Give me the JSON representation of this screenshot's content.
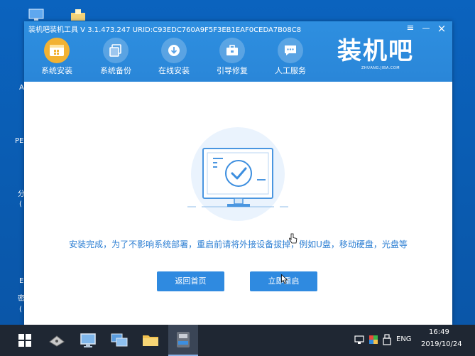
{
  "window": {
    "title": "装机吧装机工具 V 3.1.473.247 URID:C93EDC760A9F5F3EB1EAF0CEDA7B08C8",
    "controls": {
      "menu": "≡",
      "minimize": "—",
      "close": "×"
    }
  },
  "nav": {
    "items": [
      {
        "label": "系统安装",
        "icon": "windows-install-icon",
        "active": true
      },
      {
        "label": "系统备份",
        "icon": "backup-icon",
        "active": false
      },
      {
        "label": "在线安装",
        "icon": "download-icon",
        "active": false
      },
      {
        "label": "引导修复",
        "icon": "toolbox-icon",
        "active": false
      },
      {
        "label": "人工服务",
        "icon": "chat-icon",
        "active": false
      }
    ]
  },
  "logo": {
    "text": "装机吧",
    "subtitle": "ZHUANG.JIBA.COM"
  },
  "main": {
    "message": "安装完成，为了不影响系统部署，重启前请将外接设备拔掉，例如U盘，移动硬盘，光盘等",
    "buttons": {
      "home": "返回首页",
      "restart": "立即重启"
    },
    "hero_icon": "monitor-check-icon"
  },
  "desktop": {
    "fragments": [
      "A",
      "PE",
      "分",
      "(",
      "E",
      "密",
      "("
    ]
  },
  "taskbar": {
    "tray": {
      "language": "ENG",
      "time": "16:49",
      "date": "2019/10/24"
    }
  },
  "colors": {
    "accent": "#2f8ae0",
    "titlebar": "#2a86d8",
    "active_nav": "#f2b233",
    "message_text": "#2d7fd3",
    "taskbar": "#1f2733",
    "desktop": "#0a5bb0"
  }
}
